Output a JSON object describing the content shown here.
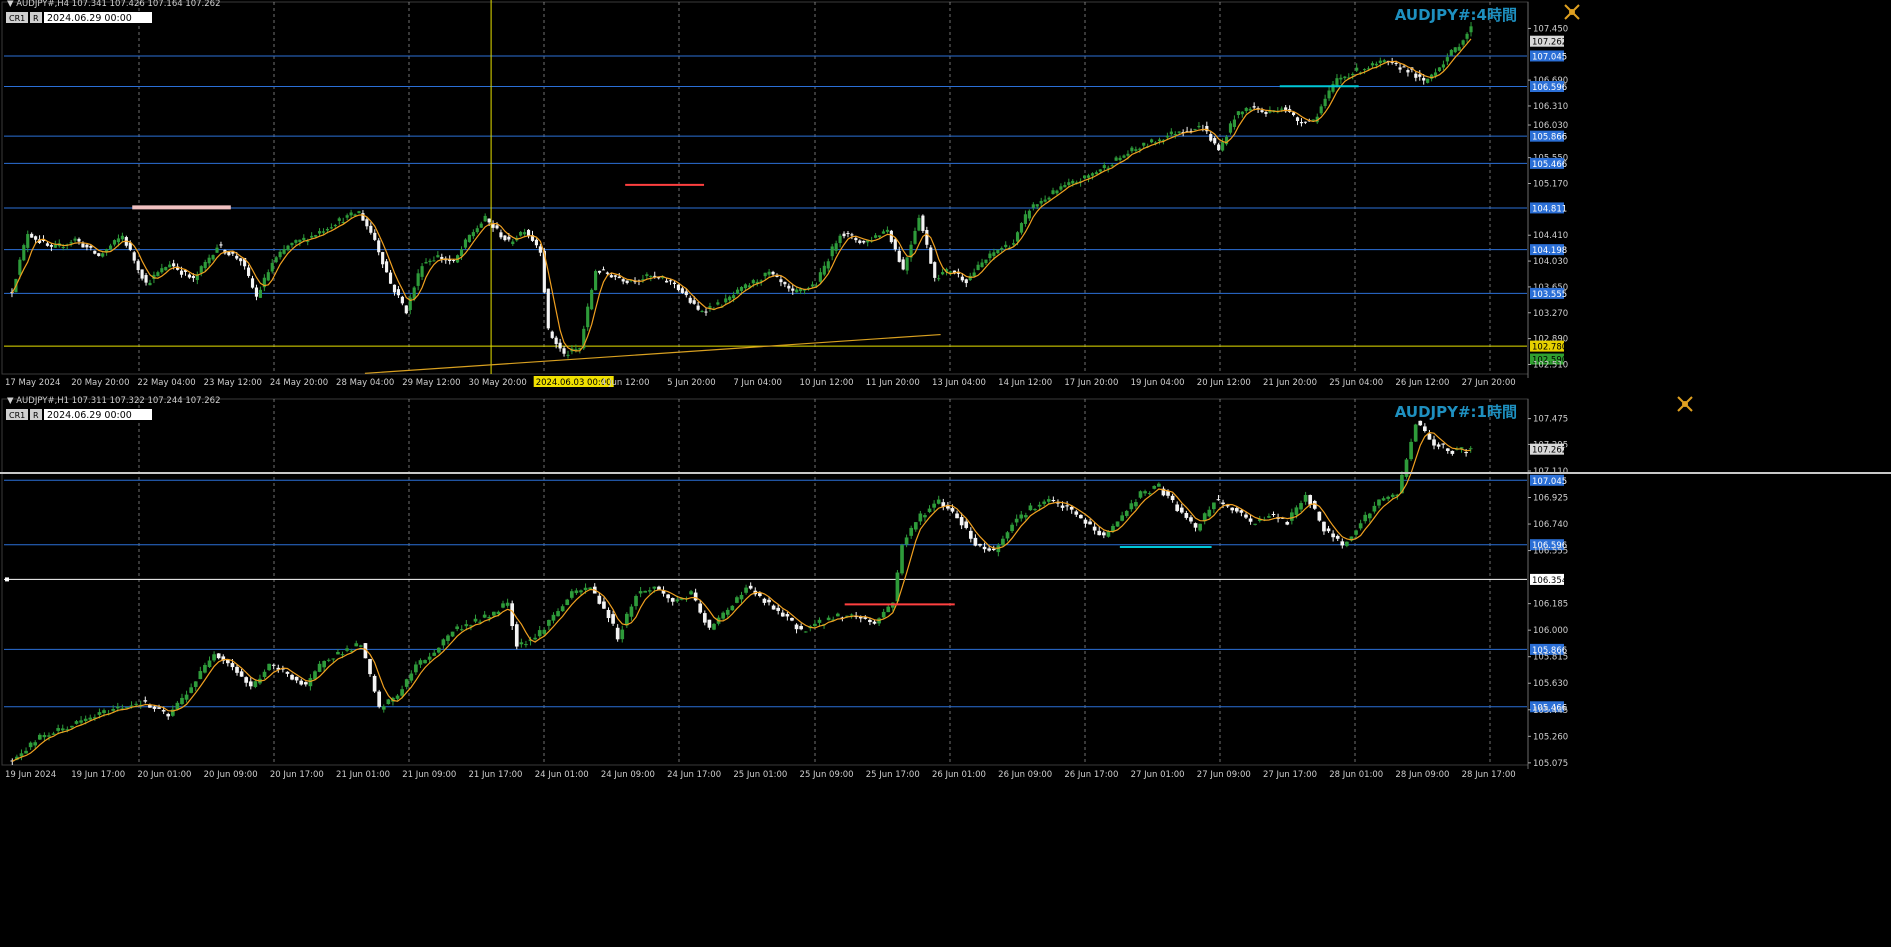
{
  "colors": {
    "background": "#000000",
    "bull_candle": "#2e9b3a",
    "bear_candle": "#f4f4f4",
    "moving_average": "#f0a020",
    "horizontal_line": "#2b6fd6",
    "price_label_bg": "#2b6fd6",
    "grid": "#ffffff",
    "title_text": "#1e90c0",
    "crosshair": "#e6e000",
    "trendline": "#d8a020",
    "red_marker": "#ff4040",
    "cyan_marker": "#00c8d8"
  },
  "chart_data": [
    {
      "type": "candlestick",
      "panel": "top",
      "symbol_header": "AUDJPY#,H4  107.341 107.426 107.164 107.262",
      "title": "AUDJPY#:4時間",
      "badge_left": "CR1",
      "badge_right": "R",
      "date_box": "2024.06.29 00:00",
      "ylim": [
        102.37,
        107.75
      ],
      "y_ticks": [
        "107.450",
        "107.262",
        "107.045",
        "106.690",
        "106.596",
        "106.310",
        "106.030",
        "105.866",
        "105.550",
        "105.466",
        "105.170",
        "104.811",
        "104.410",
        "104.198",
        "104.030",
        "103.650",
        "103.555",
        "103.270",
        "102.890",
        "102.780",
        "102.590",
        "102.510"
      ],
      "y_tick_values": [
        107.45,
        107.262,
        107.045,
        106.69,
        106.596,
        106.31,
        106.03,
        105.866,
        105.55,
        105.466,
        105.17,
        104.811,
        104.41,
        104.198,
        104.03,
        103.65,
        103.555,
        103.27,
        102.89,
        102.78,
        102.59,
        102.51
      ],
      "highlighted_labels": [
        {
          "text": "107.262",
          "kind": "current"
        },
        {
          "text": "107.045",
          "kind": "line"
        },
        {
          "text": "106.596",
          "kind": "line"
        },
        {
          "text": "105.866",
          "kind": "line"
        },
        {
          "text": "105.466",
          "kind": "line"
        },
        {
          "text": "104.811",
          "kind": "line"
        },
        {
          "text": "104.198",
          "kind": "line"
        },
        {
          "text": "103.555",
          "kind": "line"
        },
        {
          "text": "102.780",
          "kind": "yellow"
        },
        {
          "text": "102.590",
          "kind": "green"
        }
      ],
      "x_labels": [
        "17 May 2024",
        "20 May 20:00",
        "22 May 04:00",
        "23 May 12:00",
        "24 May 20:00",
        "28 May 04:00",
        "29 May 12:00",
        "30 May 20:00",
        "2024.06.03 00:00",
        "4 Jun 12:00",
        "5 Jun 20:00",
        "7 Jun 04:00",
        "10 Jun 12:00",
        "11 Jun 20:00",
        "13 Jun 04:00",
        "14 Jun 12:00",
        "17 Jun 20:00",
        "19 Jun 04:00",
        "20 Jun 12:00",
        "21 Jun 20:00",
        "25 Jun 04:00",
        "26 Jun 12:00",
        "27 Jun 20:00"
      ],
      "crosshair_label": "2024.06.03 00:00",
      "horizontal_lines": [
        107.045,
        106.596,
        105.866,
        105.466,
        104.811,
        104.198,
        103.555
      ],
      "yellow_line": 102.78,
      "key_points": [
        [
          0,
          103.6
        ],
        [
          4,
          104.45
        ],
        [
          10,
          104.2
        ],
        [
          16,
          104.35
        ],
        [
          22,
          104.1
        ],
        [
          28,
          104.4
        ],
        [
          34,
          103.7
        ],
        [
          40,
          104.0
        ],
        [
          46,
          103.75
        ],
        [
          52,
          104.25
        ],
        [
          58,
          104.05
        ],
        [
          62,
          103.5
        ],
        [
          66,
          104.0
        ],
        [
          70,
          104.25
        ],
        [
          76,
          104.4
        ],
        [
          82,
          104.6
        ],
        [
          88,
          104.75
        ],
        [
          92,
          104.35
        ],
        [
          96,
          103.7
        ],
        [
          100,
          103.3
        ],
        [
          104,
          104.0
        ],
        [
          108,
          104.1
        ],
        [
          112,
          104.0
        ],
        [
          116,
          104.4
        ],
        [
          120,
          104.65
        ],
        [
          126,
          104.3
        ],
        [
          130,
          104.5
        ],
        [
          134,
          104.2
        ],
        [
          136,
          103.0
        ],
        [
          140,
          102.65
        ],
        [
          144,
          102.75
        ],
        [
          148,
          103.9
        ],
        [
          156,
          103.75
        ],
        [
          162,
          103.8
        ],
        [
          168,
          103.7
        ],
        [
          174,
          103.3
        ],
        [
          180,
          103.4
        ],
        [
          186,
          103.65
        ],
        [
          192,
          103.85
        ],
        [
          198,
          103.55
        ],
        [
          204,
          103.7
        ],
        [
          210,
          104.45
        ],
        [
          216,
          104.3
        ],
        [
          222,
          104.5
        ],
        [
          226,
          103.9
        ],
        [
          230,
          104.7
        ],
        [
          234,
          103.8
        ],
        [
          238,
          103.9
        ],
        [
          242,
          103.75
        ],
        [
          246,
          104.0
        ],
        [
          250,
          104.2
        ],
        [
          254,
          104.3
        ],
        [
          258,
          104.8
        ],
        [
          262,
          104.95
        ],
        [
          266,
          105.1
        ],
        [
          272,
          105.25
        ],
        [
          278,
          105.45
        ],
        [
          284,
          105.65
        ],
        [
          290,
          105.8
        ],
        [
          296,
          105.95
        ],
        [
          302,
          106.0
        ],
        [
          306,
          105.65
        ],
        [
          310,
          106.15
        ],
        [
          314,
          106.3
        ],
        [
          318,
          106.2
        ],
        [
          322,
          106.3
        ],
        [
          326,
          106.1
        ],
        [
          330,
          106.1
        ],
        [
          336,
          106.7
        ],
        [
          342,
          106.85
        ],
        [
          348,
          106.95
        ],
        [
          354,
          106.85
        ],
        [
          358,
          106.65
        ],
        [
          362,
          106.9
        ],
        [
          366,
          107.15
        ],
        [
          370,
          107.45
        ]
      ],
      "n_bars": 371,
      "red_marker": {
        "price": 105.15,
        "from": 156,
        "to": 176
      },
      "white_marker": {
        "price": 104.82,
        "from": 31,
        "to": 56
      },
      "cyan_marker": {
        "price": 106.6,
        "from": 322,
        "to": 342
      },
      "trendline": {
        "from": [
          90,
          102.38
        ],
        "to": [
          236,
          102.95
        ]
      },
      "crosshair_bar": 122,
      "last_price": 107.262
    },
    {
      "type": "candlestick",
      "panel": "bottom",
      "symbol_header": "AUDJPY#,H1  107.311 107.322 107.244 107.262",
      "title": "AUDJPY#:1時間",
      "badge_left": "CR1",
      "badge_right": "R",
      "date_box": "2024.06.29 00:00",
      "ylim": [
        105.06,
        107.57
      ],
      "y_ticks": [
        "107.475",
        "107.295",
        "107.262",
        "107.110",
        "107.045",
        "106.925",
        "106.740",
        "106.596",
        "106.555",
        "106.354",
        "106.185",
        "106.000",
        "105.866",
        "105.815",
        "105.630",
        "105.466",
        "105.445",
        "105.260",
        "105.075"
      ],
      "y_tick_values": [
        107.475,
        107.295,
        107.262,
        107.11,
        107.045,
        106.925,
        106.74,
        106.596,
        106.555,
        106.354,
        106.185,
        106.0,
        105.866,
        105.815,
        105.63,
        105.466,
        105.445,
        105.26,
        105.075
      ],
      "highlighted_labels": [
        {
          "text": "107.262",
          "kind": "current"
        },
        {
          "text": "107.045",
          "kind": "line"
        },
        {
          "text": "106.596",
          "kind": "line"
        },
        {
          "text": "106.354",
          "kind": "white"
        },
        {
          "text": "105.866",
          "kind": "line"
        },
        {
          "text": "105.466",
          "kind": "line"
        }
      ],
      "x_labels": [
        "19 Jun 2024",
        "19 Jun 17:00",
        "20 Jun 01:00",
        "20 Jun 09:00",
        "20 Jun 17:00",
        "21 Jun 01:00",
        "21 Jun 09:00",
        "21 Jun 17:00",
        "24 Jun 01:00",
        "24 Jun 09:00",
        "24 Jun 17:00",
        "25 Jun 01:00",
        "25 Jun 09:00",
        "25 Jun 17:00",
        "26 Jun 01:00",
        "26 Jun 09:00",
        "26 Jun 17:00",
        "27 Jun 01:00",
        "27 Jun 09:00",
        "27 Jun 17:00",
        "28 Jun 01:00",
        "28 Jun 09:00",
        "28 Jun 17:00"
      ],
      "horizontal_lines": [
        107.045,
        106.596,
        105.866,
        105.466
      ],
      "white_line": 106.354,
      "key_points": [
        [
          0,
          105.1
        ],
        [
          6,
          105.25
        ],
        [
          14,
          105.35
        ],
        [
          22,
          105.45
        ],
        [
          28,
          105.5
        ],
        [
          34,
          105.4
        ],
        [
          40,
          105.65
        ],
        [
          44,
          105.85
        ],
        [
          48,
          105.75
        ],
        [
          52,
          105.6
        ],
        [
          56,
          105.75
        ],
        [
          60,
          105.7
        ],
        [
          64,
          105.6
        ],
        [
          68,
          105.8
        ],
        [
          72,
          105.85
        ],
        [
          76,
          105.9
        ],
        [
          80,
          105.45
        ],
        [
          84,
          105.55
        ],
        [
          88,
          105.75
        ],
        [
          92,
          105.85
        ],
        [
          96,
          106.0
        ],
        [
          100,
          106.05
        ],
        [
          104,
          106.1
        ],
        [
          108,
          106.2
        ],
        [
          110,
          105.9
        ],
        [
          114,
          105.95
        ],
        [
          118,
          106.1
        ],
        [
          122,
          106.25
        ],
        [
          126,
          106.3
        ],
        [
          130,
          106.1
        ],
        [
          132,
          105.95
        ],
        [
          136,
          106.25
        ],
        [
          140,
          106.3
        ],
        [
          144,
          106.2
        ],
        [
          148,
          106.25
        ],
        [
          152,
          106.0
        ],
        [
          156,
          106.15
        ],
        [
          160,
          106.3
        ],
        [
          164,
          106.2
        ],
        [
          168,
          106.1
        ],
        [
          172,
          106.0
        ],
        [
          176,
          106.05
        ],
        [
          180,
          106.1
        ],
        [
          184,
          106.1
        ],
        [
          188,
          106.05
        ],
        [
          192,
          106.2
        ],
        [
          194,
          106.6
        ],
        [
          198,
          106.8
        ],
        [
          202,
          106.9
        ],
        [
          206,
          106.8
        ],
        [
          210,
          106.6
        ],
        [
          214,
          106.55
        ],
        [
          218,
          106.75
        ],
        [
          222,
          106.85
        ],
        [
          226,
          106.9
        ],
        [
          230,
          106.85
        ],
        [
          234,
          106.75
        ],
        [
          238,
          106.65
        ],
        [
          242,
          106.8
        ],
        [
          246,
          106.95
        ],
        [
          250,
          107.0
        ],
        [
          254,
          106.85
        ],
        [
          258,
          106.7
        ],
        [
          262,
          106.9
        ],
        [
          266,
          106.85
        ],
        [
          270,
          106.75
        ],
        [
          274,
          106.8
        ],
        [
          278,
          106.75
        ],
        [
          282,
          106.95
        ],
        [
          286,
          106.7
        ],
        [
          290,
          106.6
        ],
        [
          294,
          106.75
        ],
        [
          298,
          106.9
        ],
        [
          302,
          106.95
        ],
        [
          306,
          107.45
        ],
        [
          310,
          107.3
        ],
        [
          314,
          107.25
        ],
        [
          318,
          107.26
        ]
      ],
      "n_bars": 319,
      "red_marker": {
        "price": 106.18,
        "from": 182,
        "to": 206
      },
      "cyan_marker": {
        "price": 106.58,
        "from": 242,
        "to": 262
      },
      "last_price": 107.262
    }
  ]
}
